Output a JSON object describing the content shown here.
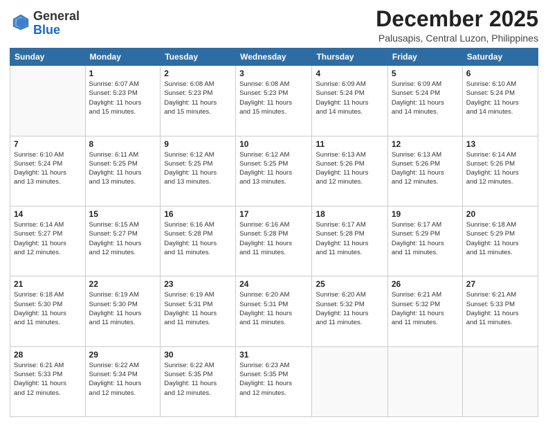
{
  "logo": {
    "general": "General",
    "blue": "Blue"
  },
  "header": {
    "month": "December 2025",
    "location": "Palusapis, Central Luzon, Philippines"
  },
  "weekdays": [
    "Sunday",
    "Monday",
    "Tuesday",
    "Wednesday",
    "Thursday",
    "Friday",
    "Saturday"
  ],
  "weeks": [
    [
      {
        "day": "",
        "info": ""
      },
      {
        "day": "1",
        "info": "Sunrise: 6:07 AM\nSunset: 5:23 PM\nDaylight: 11 hours\nand 15 minutes."
      },
      {
        "day": "2",
        "info": "Sunrise: 6:08 AM\nSunset: 5:23 PM\nDaylight: 11 hours\nand 15 minutes."
      },
      {
        "day": "3",
        "info": "Sunrise: 6:08 AM\nSunset: 5:23 PM\nDaylight: 11 hours\nand 15 minutes."
      },
      {
        "day": "4",
        "info": "Sunrise: 6:09 AM\nSunset: 5:24 PM\nDaylight: 11 hours\nand 14 minutes."
      },
      {
        "day": "5",
        "info": "Sunrise: 6:09 AM\nSunset: 5:24 PM\nDaylight: 11 hours\nand 14 minutes."
      },
      {
        "day": "6",
        "info": "Sunrise: 6:10 AM\nSunset: 5:24 PM\nDaylight: 11 hours\nand 14 minutes."
      }
    ],
    [
      {
        "day": "7",
        "info": "Sunrise: 6:10 AM\nSunset: 5:24 PM\nDaylight: 11 hours\nand 13 minutes."
      },
      {
        "day": "8",
        "info": "Sunrise: 6:11 AM\nSunset: 5:25 PM\nDaylight: 11 hours\nand 13 minutes."
      },
      {
        "day": "9",
        "info": "Sunrise: 6:12 AM\nSunset: 5:25 PM\nDaylight: 11 hours\nand 13 minutes."
      },
      {
        "day": "10",
        "info": "Sunrise: 6:12 AM\nSunset: 5:25 PM\nDaylight: 11 hours\nand 13 minutes."
      },
      {
        "day": "11",
        "info": "Sunrise: 6:13 AM\nSunset: 5:26 PM\nDaylight: 11 hours\nand 12 minutes."
      },
      {
        "day": "12",
        "info": "Sunrise: 6:13 AM\nSunset: 5:26 PM\nDaylight: 11 hours\nand 12 minutes."
      },
      {
        "day": "13",
        "info": "Sunrise: 6:14 AM\nSunset: 5:26 PM\nDaylight: 11 hours\nand 12 minutes."
      }
    ],
    [
      {
        "day": "14",
        "info": "Sunrise: 6:14 AM\nSunset: 5:27 PM\nDaylight: 11 hours\nand 12 minutes."
      },
      {
        "day": "15",
        "info": "Sunrise: 6:15 AM\nSunset: 5:27 PM\nDaylight: 11 hours\nand 12 minutes."
      },
      {
        "day": "16",
        "info": "Sunrise: 6:16 AM\nSunset: 5:28 PM\nDaylight: 11 hours\nand 11 minutes."
      },
      {
        "day": "17",
        "info": "Sunrise: 6:16 AM\nSunset: 5:28 PM\nDaylight: 11 hours\nand 11 minutes."
      },
      {
        "day": "18",
        "info": "Sunrise: 6:17 AM\nSunset: 5:28 PM\nDaylight: 11 hours\nand 11 minutes."
      },
      {
        "day": "19",
        "info": "Sunrise: 6:17 AM\nSunset: 5:29 PM\nDaylight: 11 hours\nand 11 minutes."
      },
      {
        "day": "20",
        "info": "Sunrise: 6:18 AM\nSunset: 5:29 PM\nDaylight: 11 hours\nand 11 minutes."
      }
    ],
    [
      {
        "day": "21",
        "info": "Sunrise: 6:18 AM\nSunset: 5:30 PM\nDaylight: 11 hours\nand 11 minutes."
      },
      {
        "day": "22",
        "info": "Sunrise: 6:19 AM\nSunset: 5:30 PM\nDaylight: 11 hours\nand 11 minutes."
      },
      {
        "day": "23",
        "info": "Sunrise: 6:19 AM\nSunset: 5:31 PM\nDaylight: 11 hours\nand 11 minutes."
      },
      {
        "day": "24",
        "info": "Sunrise: 6:20 AM\nSunset: 5:31 PM\nDaylight: 11 hours\nand 11 minutes."
      },
      {
        "day": "25",
        "info": "Sunrise: 6:20 AM\nSunset: 5:32 PM\nDaylight: 11 hours\nand 11 minutes."
      },
      {
        "day": "26",
        "info": "Sunrise: 6:21 AM\nSunset: 5:32 PM\nDaylight: 11 hours\nand 11 minutes."
      },
      {
        "day": "27",
        "info": "Sunrise: 6:21 AM\nSunset: 5:33 PM\nDaylight: 11 hours\nand 11 minutes."
      }
    ],
    [
      {
        "day": "28",
        "info": "Sunrise: 6:21 AM\nSunset: 5:33 PM\nDaylight: 11 hours\nand 12 minutes."
      },
      {
        "day": "29",
        "info": "Sunrise: 6:22 AM\nSunset: 5:34 PM\nDaylight: 11 hours\nand 12 minutes."
      },
      {
        "day": "30",
        "info": "Sunrise: 6:22 AM\nSunset: 5:35 PM\nDaylight: 11 hours\nand 12 minutes."
      },
      {
        "day": "31",
        "info": "Sunrise: 6:23 AM\nSunset: 5:35 PM\nDaylight: 11 hours\nand 12 minutes."
      },
      {
        "day": "",
        "info": ""
      },
      {
        "day": "",
        "info": ""
      },
      {
        "day": "",
        "info": ""
      }
    ]
  ]
}
